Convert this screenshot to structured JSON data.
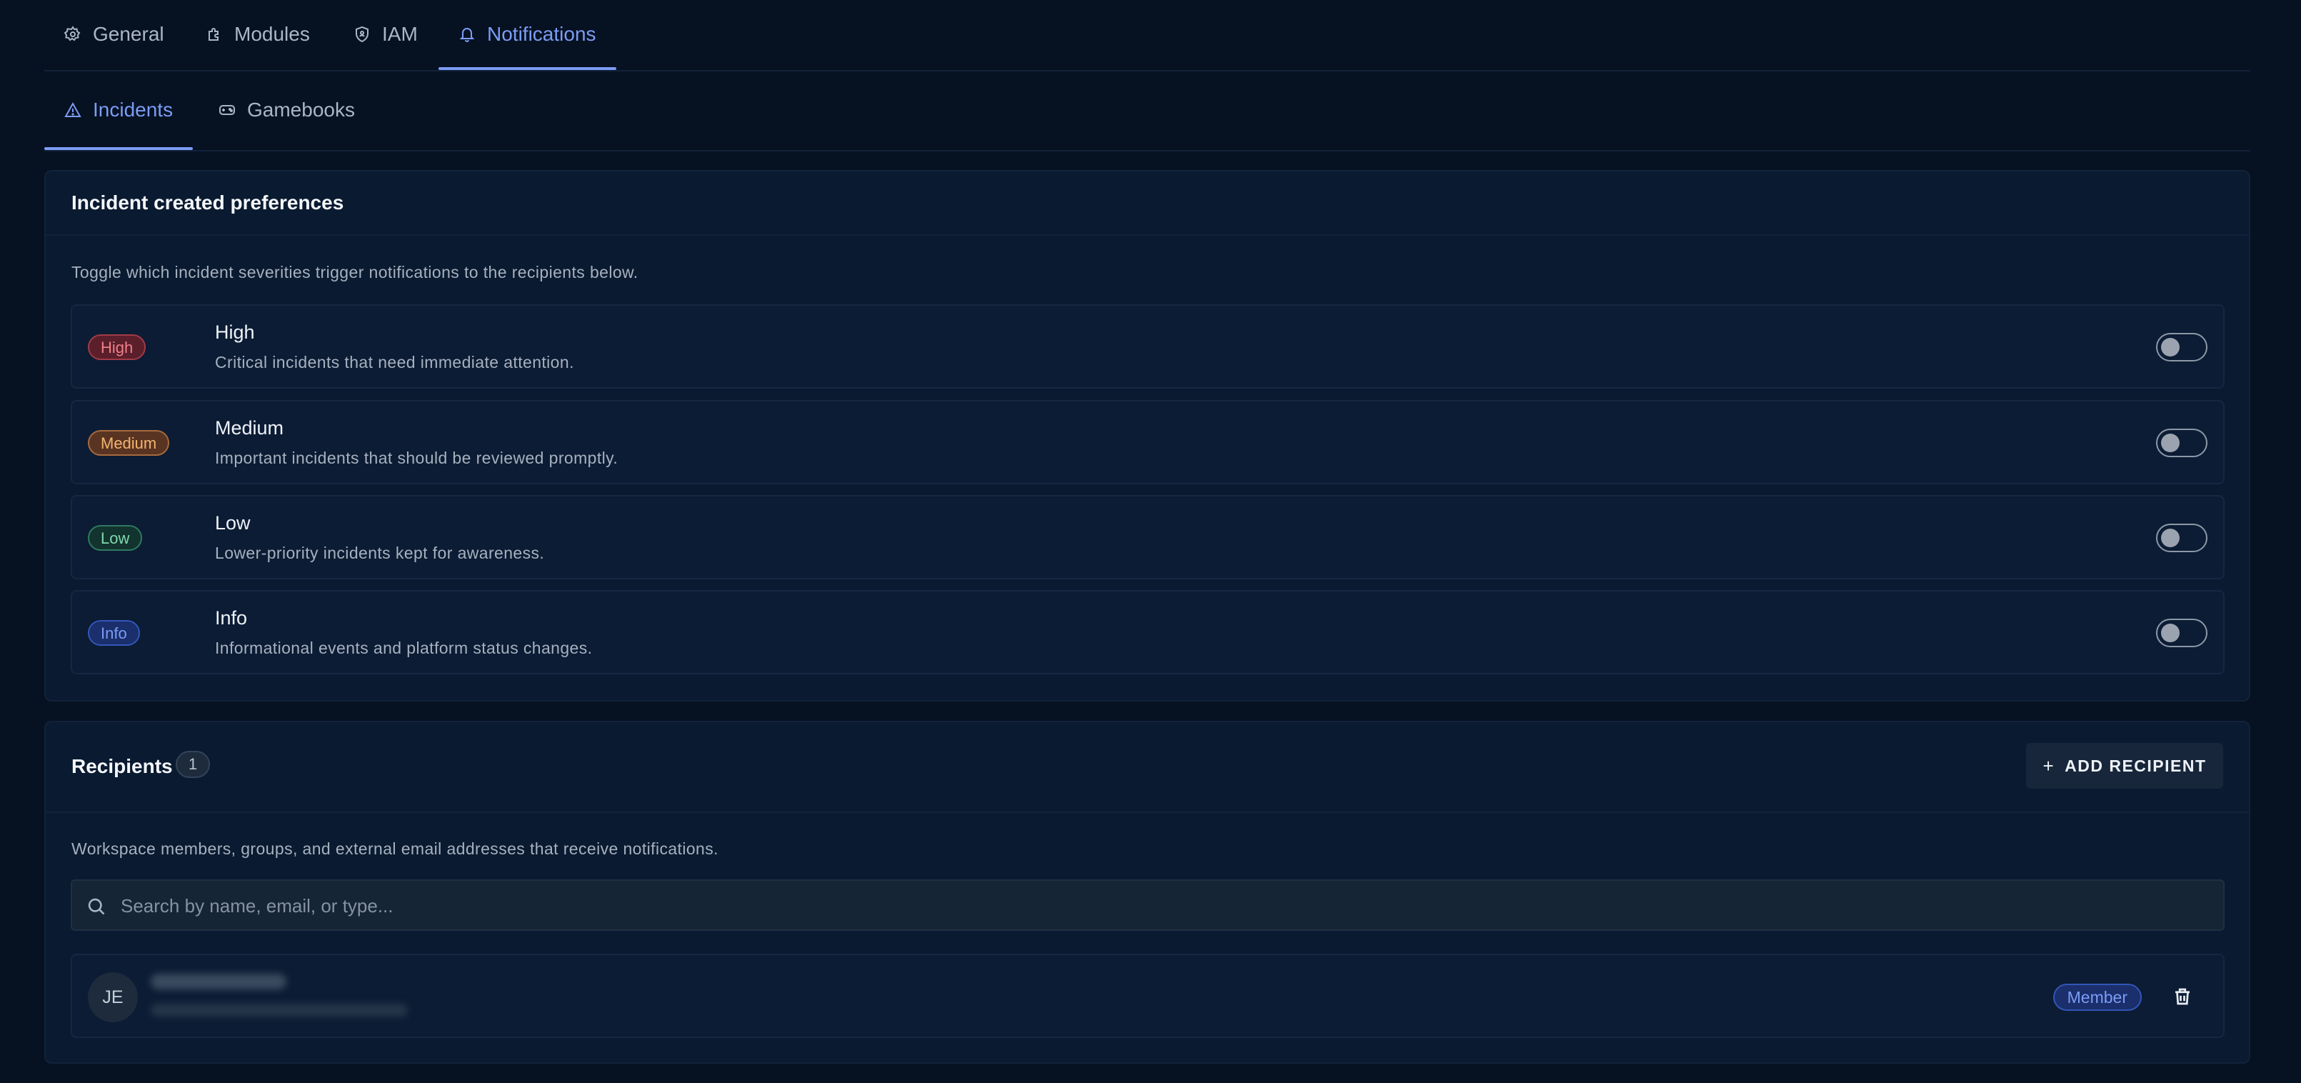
{
  "top_tabs": [
    {
      "label": "General",
      "icon": "gear-icon"
    },
    {
      "label": "Modules",
      "icon": "puzzle-icon"
    },
    {
      "label": "IAM",
      "icon": "shield-icon"
    },
    {
      "label": "Notifications",
      "icon": "bell-icon",
      "active": true
    }
  ],
  "sub_tabs": [
    {
      "label": "Incidents",
      "icon": "warning-triangle-icon",
      "active": true
    },
    {
      "label": "Gamebooks",
      "icon": "gamepad-icon"
    }
  ],
  "incident_prefs": {
    "title": "Incident created preferences",
    "description": "Toggle which incident severities trigger notifications to the recipients below.",
    "severities": [
      {
        "badge": "High",
        "name": "High",
        "description": "Critical incidents that need immediate attention.",
        "enabled": false,
        "color": "#f07f8a"
      },
      {
        "badge": "Medium",
        "name": "Medium",
        "description": "Important incidents that should be reviewed promptly.",
        "enabled": false,
        "color": "#f2b36f"
      },
      {
        "badge": "Low",
        "name": "Low",
        "description": "Lower-priority incidents kept for awareness.",
        "enabled": false,
        "color": "#7fd9ad"
      },
      {
        "badge": "Info",
        "name": "Info",
        "description": "Informational events and platform status changes.",
        "enabled": false,
        "color": "#7c9cf5"
      }
    ]
  },
  "recipients": {
    "title": "Recipients",
    "count": "1",
    "add_label": "ADD RECIPIENT",
    "description": "Workspace members, groups, and external email addresses that receive notifications.",
    "search_placeholder": "Search by name, email, or type...",
    "members": [
      {
        "initials": "JE",
        "role": "Member"
      }
    ]
  },
  "colors": {
    "accent": "#7c9cf5",
    "background": "#061121",
    "card": "#0a1a30"
  }
}
